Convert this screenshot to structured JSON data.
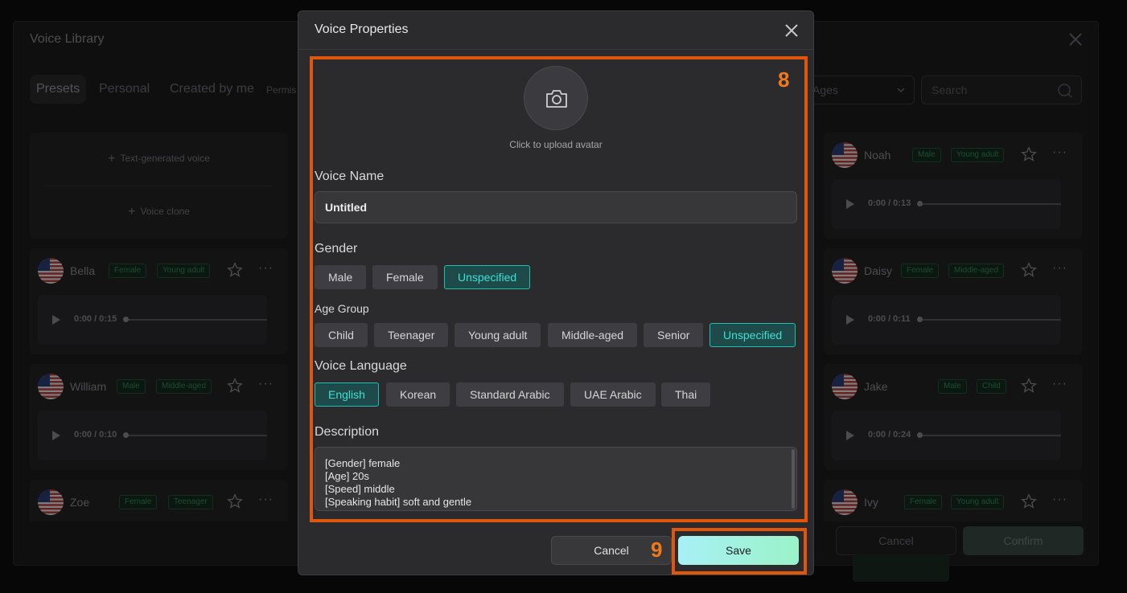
{
  "library": {
    "title": "Voice Library",
    "tabs": [
      "Presets",
      "Personal",
      "Created by me"
    ],
    "permission_text": "Permis",
    "ages_select": "Ages",
    "search_placeholder": "Search",
    "create": {
      "text_generated": "Text-generated voice",
      "voice_clone": "Voice clone"
    },
    "voices_left": [
      {
        "name": "Bella",
        "badges": [
          "Female",
          "Young adult"
        ],
        "time": "0:00 / 0:15"
      },
      {
        "name": "William",
        "badges": [
          "Male",
          "Middle-aged"
        ],
        "time": "0:00 / 0:10"
      },
      {
        "name": "Zoe",
        "badges": [
          "Female",
          "Teenager"
        ],
        "time": ""
      }
    ],
    "voices_right": [
      {
        "name": "Noah",
        "badges": [
          "Male",
          "Young adult"
        ],
        "time": "0:00 / 0:13"
      },
      {
        "name": "Daisy",
        "badges": [
          "Female",
          "Middle-aged"
        ],
        "time": "0:00 / 0:11"
      },
      {
        "name": "Jake",
        "badges": [
          "Male",
          "Child"
        ],
        "time": "0:00 / 0:24"
      },
      {
        "name": "Ivy",
        "badges": [
          "Female",
          "Young adult"
        ],
        "time": ""
      }
    ],
    "cancel_label": "Cancel",
    "confirm_label": "Confirm"
  },
  "modal": {
    "title": "Voice Properties",
    "avatar_label": "Click to upload avatar",
    "voice_name_label": "Voice Name",
    "voice_name_value": "Untitled",
    "gender_label": "Gender",
    "gender_options": [
      "Male",
      "Female",
      "Unspecified"
    ],
    "gender_selected": "Unspecified",
    "age_label": "Age Group",
    "age_options": [
      "Child",
      "Teenager",
      "Young adult",
      "Middle-aged",
      "Senior",
      "Unspecified"
    ],
    "age_selected": "Unspecified",
    "language_label": "Voice Language",
    "language_options": [
      "English",
      "Korean",
      "Standard Arabic",
      "UAE Arabic",
      "Thai"
    ],
    "language_selected": "English",
    "description_label": "Description",
    "description_lines": [
      "[Gender] female",
      "[Age] 20s",
      "[Speed] middle",
      "[Speaking habit] soft and gentle"
    ],
    "cancel_label": "Cancel",
    "save_label": "Save"
  },
  "annotations": {
    "box_8": "8",
    "box_9": "9",
    "color": "#e0560d"
  },
  "colors": {
    "accent_teal": "#1fbfb8",
    "badge_green": "#2f8f55",
    "save_gradient_start": "#a8f0f6",
    "save_gradient_end": "#9af3c8"
  }
}
